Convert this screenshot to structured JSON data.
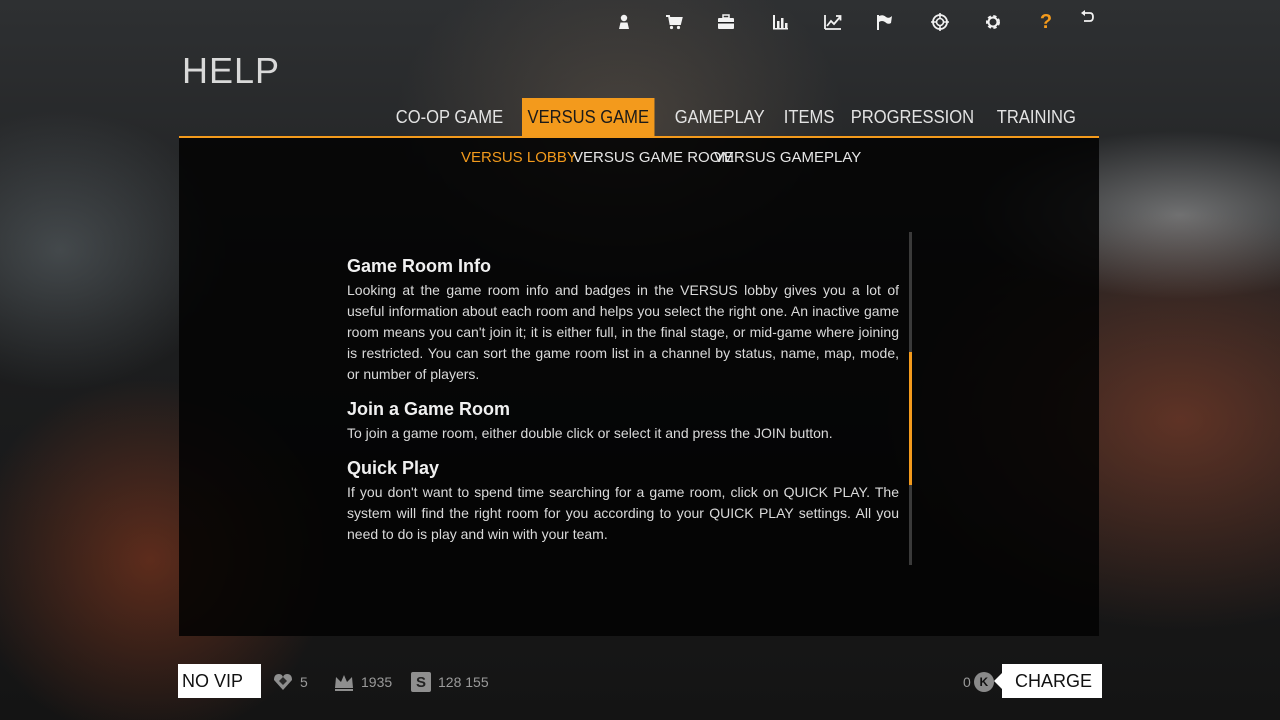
{
  "top_nav": {
    "icons": [
      "profile-icon",
      "shop-icon",
      "inventory-icon",
      "statistics-icon",
      "progress-icon",
      "missions-flag-icon",
      "target-icon",
      "settings-icon",
      "help-icon",
      "back-icon"
    ],
    "help_glyph": "?",
    "accent": "#f39a1c"
  },
  "page": {
    "title": "HELP"
  },
  "tabs": [
    {
      "label": "CO-OP GAME",
      "active": false
    },
    {
      "label": "VERSUS GAME",
      "active": true
    },
    {
      "label": "GAMEPLAY",
      "active": false
    },
    {
      "label": "ITEMS",
      "active": false
    },
    {
      "label": "PROGRESSION",
      "active": false
    },
    {
      "label": "TRAINING",
      "active": false
    }
  ],
  "subtabs": [
    {
      "label": "VERSUS LOBBY",
      "active": true
    },
    {
      "label": "VERSUS GAME ROOM",
      "active": false
    },
    {
      "label": "VERSUS GAMEPLAY",
      "active": false
    }
  ],
  "sections": [
    {
      "heading": "Game Room Info",
      "body": "Looking at the game room info and badges in the VERSUS lobby gives you a lot of useful information about each room and helps you select the right one. An inactive game room means you can't join it; it is either full, in the final stage, or mid-game where joining is restricted. You can sort the game room list in a channel by status, name, map, mode, or number of players."
    },
    {
      "heading": "Join a Game Room",
      "body": "To join a game room, either double click or select it and press the JOIN button."
    },
    {
      "heading": "Quick Play",
      "body": "If you don't want to spend time searching for a game room, click on QUICK PLAY. The system will find the right room for you according to your QUICK PLAY settings. All you need to do is play and win with your team."
    }
  ],
  "scrollbar": {
    "position_fraction": 0.36,
    "visible_fraction": 0.4
  },
  "footer": {
    "vip_label": "NO VIP",
    "hearts": "5",
    "crowns": "1935",
    "money": "128 155",
    "k_balance": "0",
    "k_glyph": "K",
    "charge_label": "CHARGE"
  }
}
